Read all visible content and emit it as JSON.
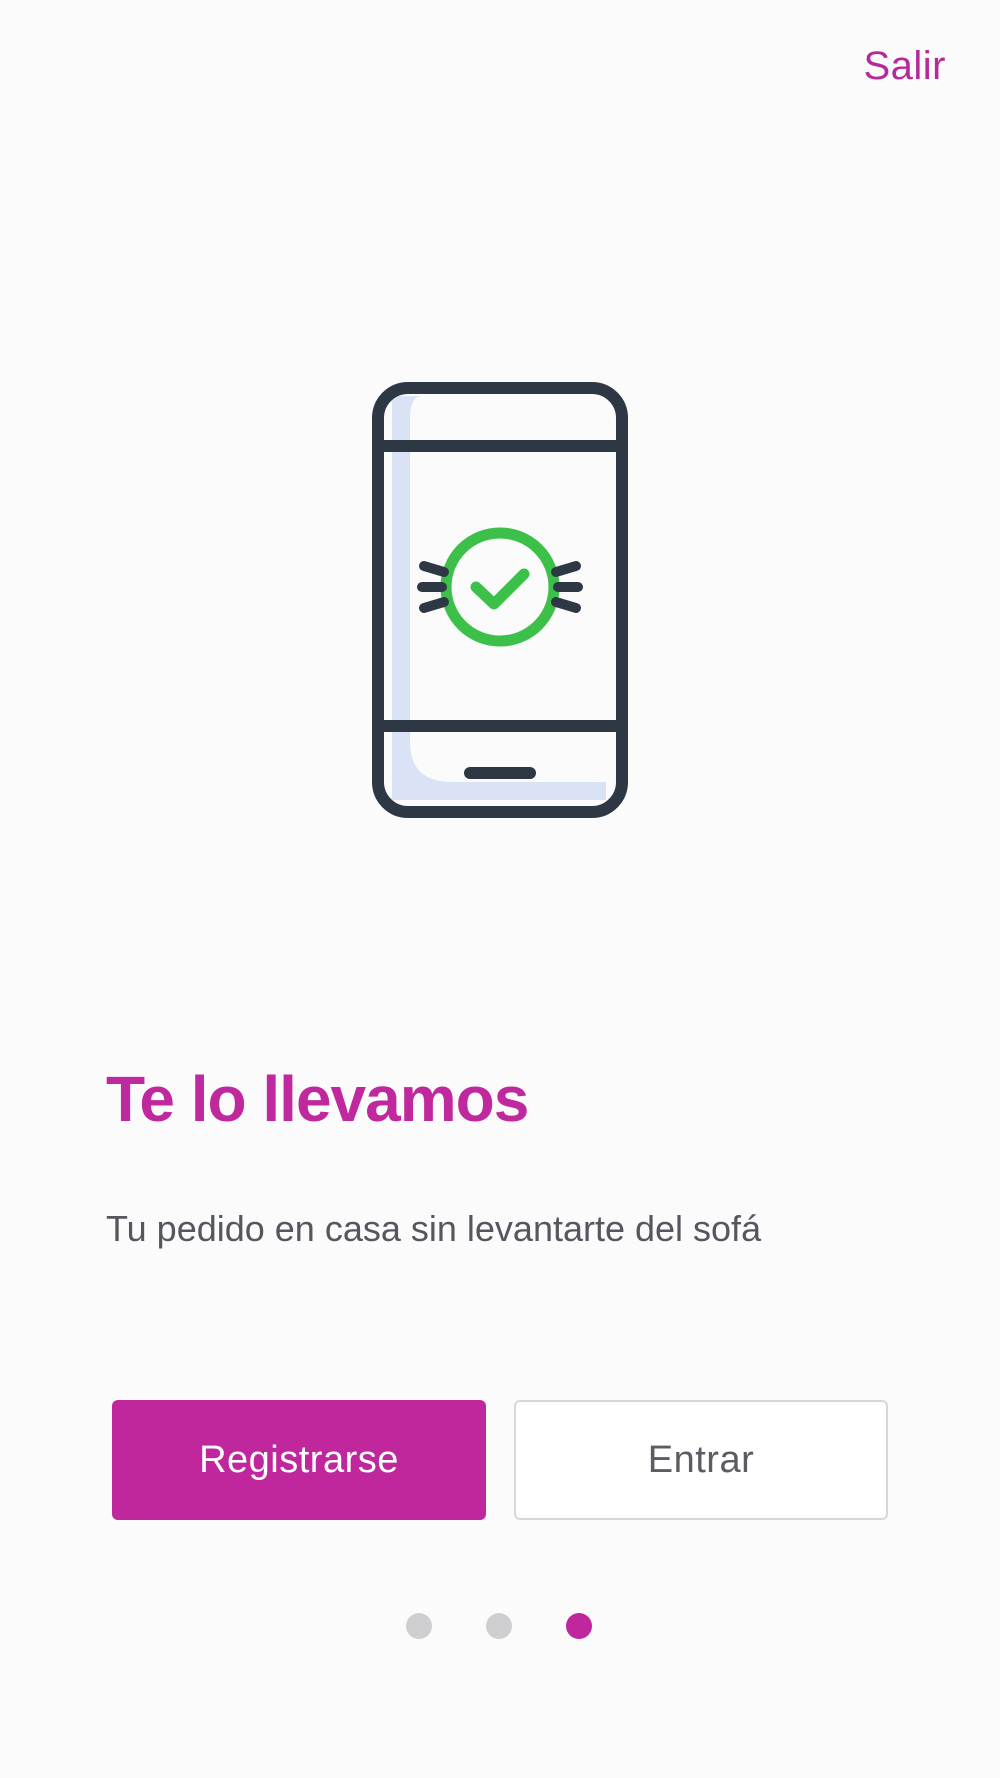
{
  "header": {
    "exit_label": "Salir"
  },
  "illustration": {
    "icon": "phone-check-icon"
  },
  "content": {
    "title": "Te lo llevamos",
    "subtitle": "Tu pedido en casa sin levantarte del sofá"
  },
  "actions": {
    "register_label": "Registrarse",
    "login_label": "Entrar"
  },
  "pagination": {
    "total": 3,
    "current": 3
  },
  "colors": {
    "accent": "#c0279d",
    "background": "#fbfbfc",
    "check": "#3cc04a",
    "outline": "#2e3744",
    "screen_tint": "#d9e3f5"
  }
}
